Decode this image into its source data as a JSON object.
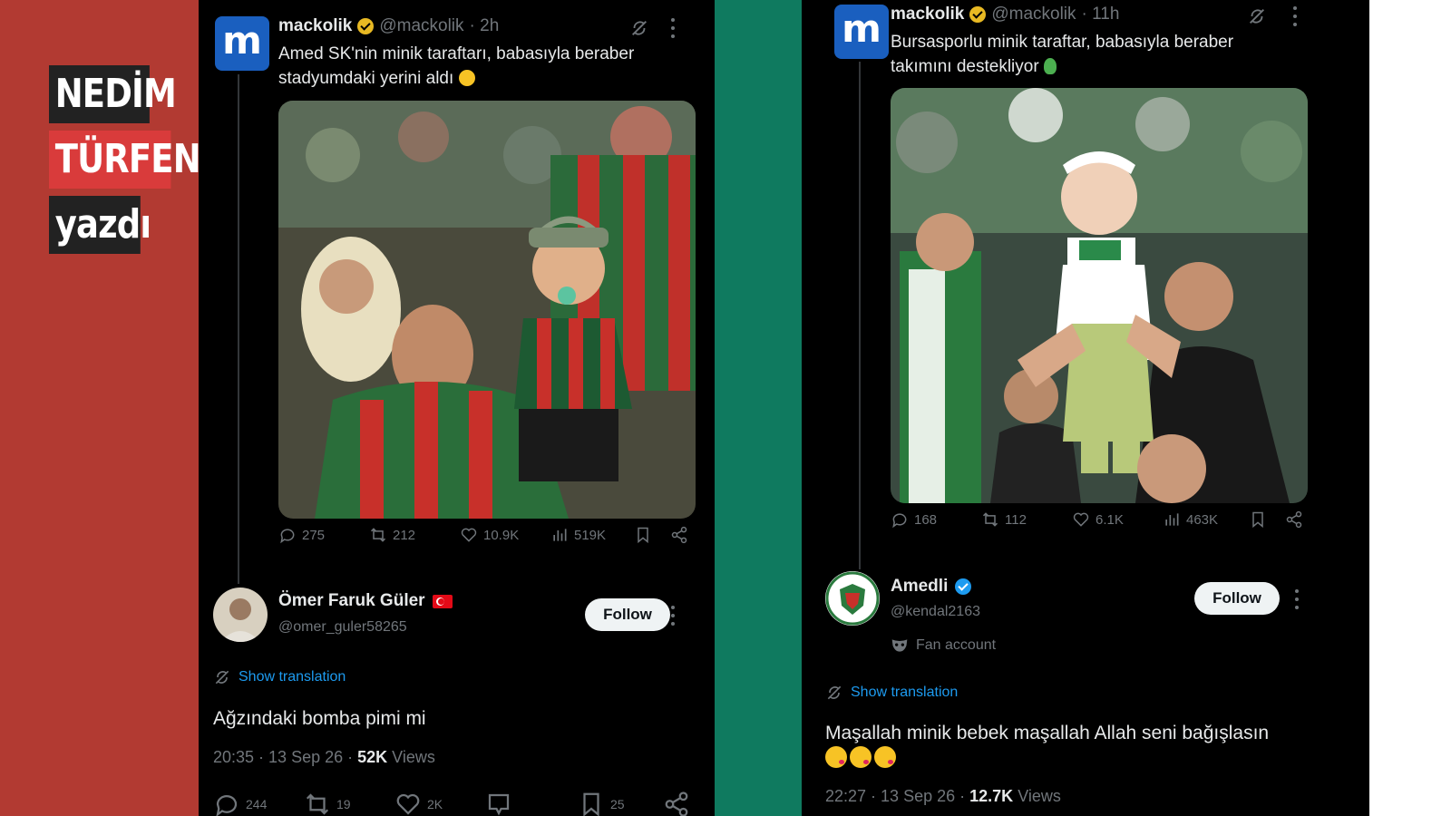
{
  "colors": {
    "accent_red": "#b23a32",
    "accent_green": "#0f7a5f",
    "link_blue": "#1d9bf0",
    "background": "#000000"
  },
  "byline": {
    "line1": "NEDİM",
    "line2": "TÜRFENT",
    "line3": "yazdı"
  },
  "left_tweet": {
    "avatar_letter": "m",
    "name": "mackolik",
    "handle": "@mackolik",
    "time": "· 2h",
    "text_line1": "Amed SK'nin minik taraftarı, babasıyla beraber",
    "text_line2": "stadyumdaki yerini aldı",
    "image_alt": "father holding baby in Amed SK jersey at stadium",
    "stats": {
      "replies": "275",
      "retweets": "212",
      "likes": "10.9K",
      "views": "519K"
    },
    "reply": {
      "name": "Ömer Faruk Güler",
      "handle": "@omer_guler58265",
      "follow_label": "Follow",
      "show_translation": "Show translation",
      "text": "Ağzındaki bomba pimi mi",
      "timestamp": "20:35 · 13 Sep 26 ·",
      "views_count": "52K",
      "views_label": "Views",
      "bottom_stats": {
        "replies": "244",
        "retweets": "19",
        "likes": "2K",
        "bookmarks": "25"
      }
    }
  },
  "right_tweet": {
    "avatar_letter": "m",
    "name": "mackolik",
    "handle": "@mackolik",
    "time": "· 11h",
    "text_line1": "Bursasporlu minik taraftar, babasıyla beraber",
    "text_line2": "takımını destekliyor",
    "image_alt": "father lifting baby in Bursaspor colors at stadium",
    "stats": {
      "replies": "168",
      "retweets": "112",
      "likes": "6.1K",
      "views": "463K"
    },
    "reply": {
      "name": "Amedli",
      "handle": "@kendal2163",
      "fan_account": "Fan account",
      "follow_label": "Follow",
      "show_translation": "Show translation",
      "text": "Maşallah minik bebek maşallah Allah seni bağışlasın",
      "timestamp": "22:27 · 13 Sep 26 ·",
      "views_count": "12.7K",
      "views_label": "Views"
    }
  },
  "icons": [
    "grok-icon",
    "more-icon",
    "reply-icon",
    "retweet-icon",
    "like-icon",
    "views-icon",
    "bookmark-icon",
    "share-icon",
    "translate-icon",
    "verified-badge-icon",
    "flag-icon",
    "mask-icon"
  ]
}
